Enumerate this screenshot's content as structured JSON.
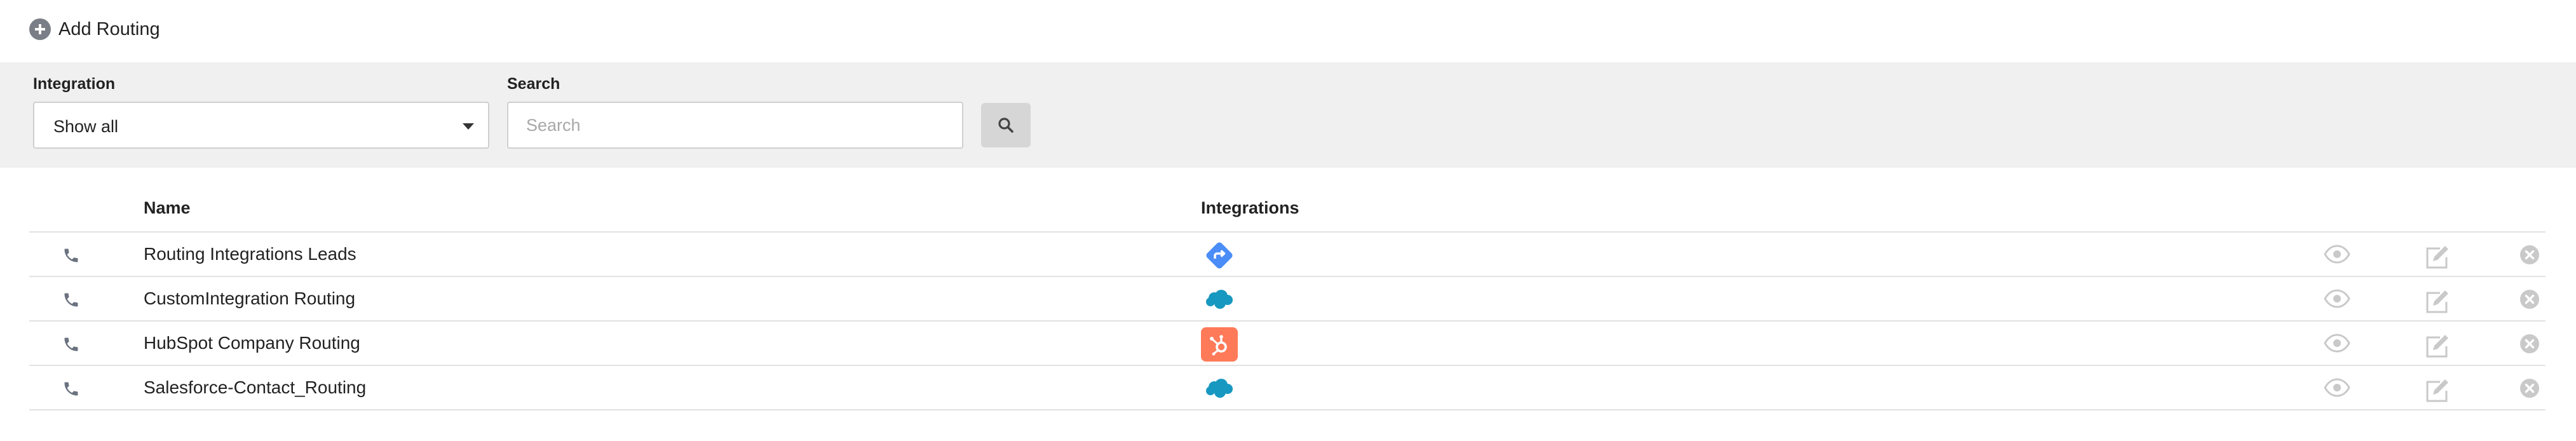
{
  "toolbar": {
    "add_label": "Add Routing",
    "add_icon": "plus-circle-icon"
  },
  "filters": {
    "integration_label": "Integration",
    "integration_value": "Show all",
    "search_label": "Search",
    "search_placeholder": "Search",
    "search_value": ""
  },
  "table": {
    "headers": {
      "name": "Name",
      "integrations": "Integrations"
    },
    "rows": [
      {
        "name": "Routing Integrations Leads",
        "integration": "routing-integration-icon"
      },
      {
        "name": "CustomIntegration Routing",
        "integration": "salesforce-icon"
      },
      {
        "name": "HubSpot Company Routing",
        "integration": "hubspot-icon"
      },
      {
        "name": "Salesforce-Contact_Routing",
        "integration": "salesforce-icon"
      }
    ]
  },
  "colors": {
    "filter_bg": "#f0f0f0",
    "routing_blue": "#4b8df8",
    "salesforce_blue": "#1798c1",
    "hubspot_orange": "#ff7a59",
    "icon_gray": "#6b7280",
    "action_gray": "#c9c9c9"
  }
}
